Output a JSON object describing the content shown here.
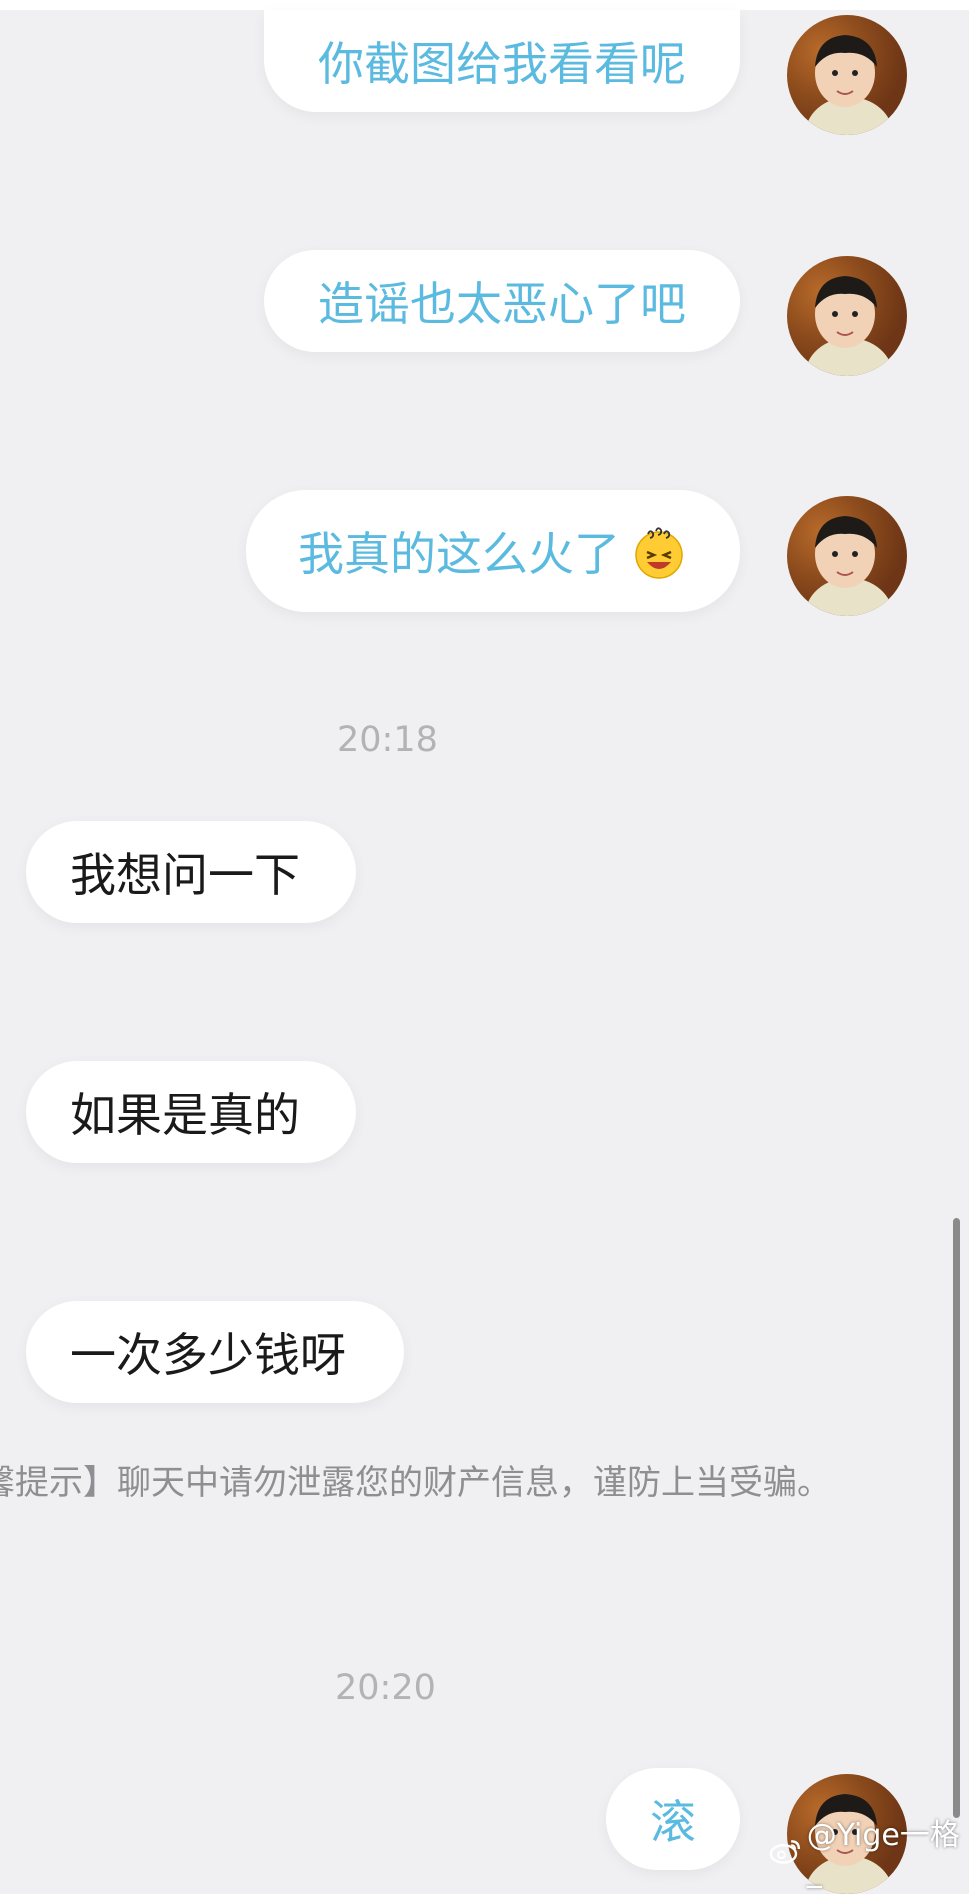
{
  "messages": [
    {
      "text": "你截图给我看看呢"
    },
    {
      "text": "造谣也太恶心了吧"
    },
    {
      "text": "我真的这么火了"
    },
    {
      "text": "我想问一下"
    },
    {
      "text": "如果是真的"
    },
    {
      "text": "一次多少钱呀"
    },
    {
      "text": "滚"
    }
  ],
  "timestamps": [
    "20:18",
    "20:20"
  ],
  "system_tip": "馨提示】聊天中请勿泄露您的财产信息，谨防上当受骗。",
  "watermark": "@Yige一格_",
  "emoji_name": "dizzy-face-emoji",
  "colors": {
    "outgoing_text": "#5bbadf",
    "incoming_text": "#1a1a1a",
    "background": "#f0f0f2"
  }
}
